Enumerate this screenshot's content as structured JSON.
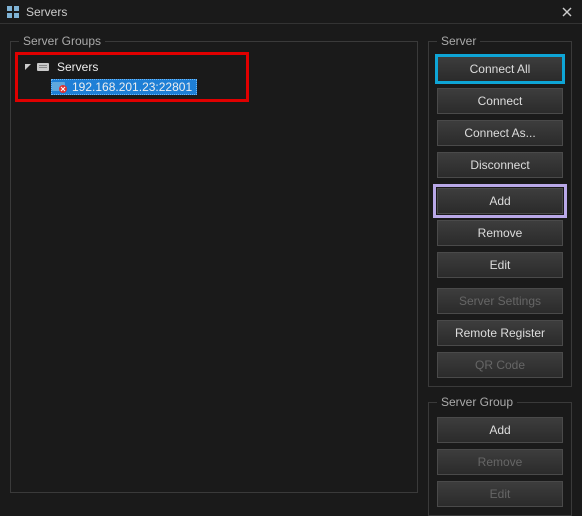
{
  "window": {
    "title": "Servers"
  },
  "server_groups": {
    "legend": "Server Groups",
    "root": {
      "label": "Servers",
      "expanded": true
    },
    "child": {
      "label": "192.168.201.23:22801",
      "selected": true
    }
  },
  "server_panel": {
    "legend": "Server",
    "buttons": {
      "connect_all": "Connect All",
      "connect": "Connect",
      "connect_as": "Connect As...",
      "disconnect": "Disconnect",
      "add": "Add",
      "remove": "Remove",
      "edit": "Edit",
      "server_settings": "Server Settings",
      "remote_register": "Remote Register",
      "qr_code": "QR Code"
    }
  },
  "server_group_panel": {
    "legend": "Server Group",
    "buttons": {
      "add": "Add",
      "remove": "Remove",
      "edit": "Edit"
    }
  }
}
